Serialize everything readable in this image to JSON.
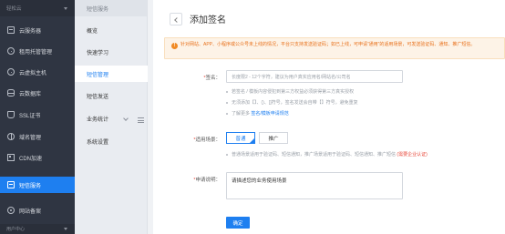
{
  "nav": {
    "top_label": "轻松云",
    "items": [
      {
        "label": "云服务器"
      },
      {
        "label": "租用托管管理"
      },
      {
        "label": "云虚拟主机"
      },
      {
        "label": "云数据库"
      },
      {
        "label": "SSL证书"
      },
      {
        "label": "域名管理"
      },
      {
        "label": "CDN加速"
      },
      {
        "label": "短信服务"
      },
      {
        "label": "网站备案"
      }
    ],
    "active_index": 7,
    "bottom_label": "用户中心"
  },
  "submenu": {
    "head": "短信服务",
    "items": [
      {
        "label": "概览"
      },
      {
        "label": "快速学习"
      },
      {
        "label": "短信管理"
      },
      {
        "label": "短信发送"
      },
      {
        "label": "业务统计"
      },
      {
        "label": "系统设置"
      }
    ],
    "active_index": 2
  },
  "page": {
    "title": "添加签名",
    "notice": "针对网站、APP、小程序或公众号未上线的情况，平台只支持发送验证码；如已上线，可申请“通用”的适用场景，可发送验证码、通知、推广短信。"
  },
  "form": {
    "sign_label": "签名：",
    "sign_placeholder": "长度限2 - 12个字符，建议为用户真实应用名/网站名/公司名",
    "sign_hints": [
      "若签名 / 模板内容侵犯到第三方权益必须获得第三方真实授权",
      "无须添加【】、()、[]符号，签名发送会自带【】符号，避免重复",
      "了解更多"
    ],
    "sign_hint_link": "签名/模板申请规范",
    "scene_label": "适用场景：",
    "scene_options": [
      "普通",
      "推广"
    ],
    "scene_selected": 0,
    "scene_hint": "普通场景适用于验证码、短信通知，推广场景适用于验证码、短信通知、推广短信",
    "scene_hint_red": "(需要企业认证)",
    "desc_label": "申请说明：",
    "desc_value": "请描述您的业务使用场景",
    "submit_label": "确定"
  }
}
